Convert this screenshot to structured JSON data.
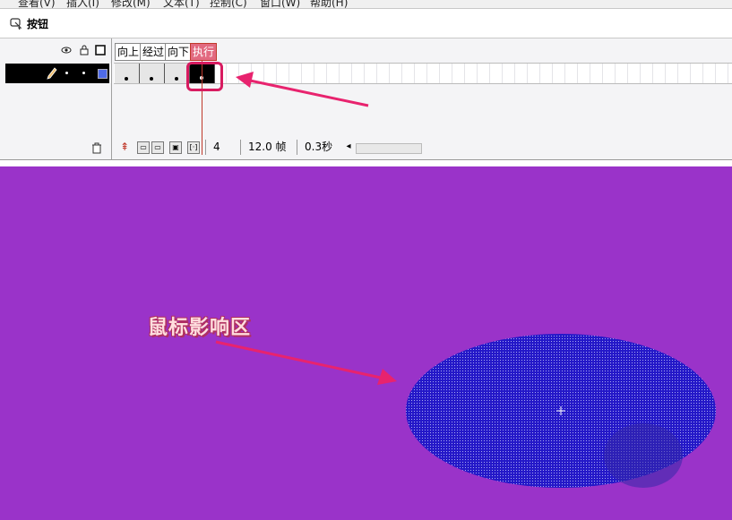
{
  "menu": [
    "查看(V)",
    "插入(I)",
    "修改(M)",
    "文本(T)",
    "控制(C)",
    "窗口(W)",
    "帮助(H)"
  ],
  "scene": {
    "name": "按钮"
  },
  "timeline": {
    "frame_labels": [
      "向上",
      "经过",
      "向下",
      "执行"
    ],
    "current_frame": "4",
    "frame_rate": "12.0 帧",
    "elapsed_time": "0.3秒"
  },
  "stage": {
    "annotation": "鼠标影响区",
    "background_color": "#9a33c9",
    "hit_area_color": "#2418c8"
  },
  "colors": {
    "highlight": "#d81b60",
    "arrow": "#e8236e",
    "playhead": "#c0392b"
  }
}
